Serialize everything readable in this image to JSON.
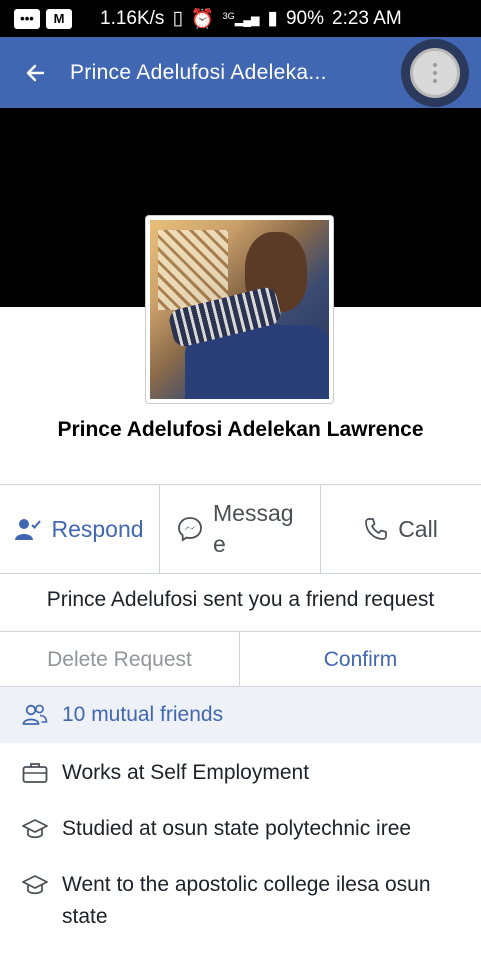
{
  "status_bar": {
    "speed": "1.16K/s",
    "network": "3G",
    "battery": "90%",
    "time": "2:23 AM"
  },
  "app_bar": {
    "title": "Prince Adelufosi Adeleka...",
    "back_icon": "back-arrow-icon",
    "more_icon": "more-vertical-icon",
    "color": "#4267b2"
  },
  "profile": {
    "name": "Prince Adelufosi Adelekan Lawrence"
  },
  "actions": {
    "respond": "Respond",
    "message": "Messag e",
    "call": "Call"
  },
  "friend_request": {
    "text": "Prince Adelufosi sent you a friend request",
    "delete_label": "Delete Request",
    "confirm_label": "Confirm"
  },
  "details": {
    "mutual_friends": "10 mutual friends",
    "work": "Works at Self Employment",
    "study": "Studied at osun state polytechnic iree",
    "college": "Went to the apostolic college ilesa osun state"
  },
  "colors": {
    "accent": "#4267b2",
    "muted": "#90949c",
    "mutual_bg": "#eef2f8"
  }
}
